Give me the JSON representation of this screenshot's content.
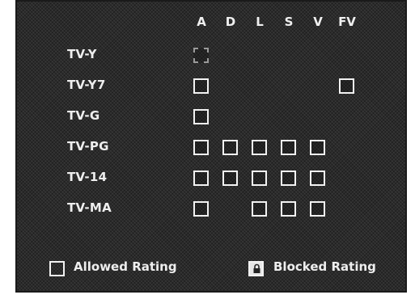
{
  "columns": [
    "A",
    "D",
    "L",
    "S",
    "V",
    "FV"
  ],
  "rows": [
    {
      "label": "TV-Y",
      "cells": [
        "A"
      ]
    },
    {
      "label": "TV-Y7",
      "cells": [
        "A",
        "FV"
      ]
    },
    {
      "label": "TV-G",
      "cells": [
        "A"
      ]
    },
    {
      "label": "TV-PG",
      "cells": [
        "A",
        "D",
        "L",
        "S",
        "V"
      ]
    },
    {
      "label": "TV-14",
      "cells": [
        "A",
        "D",
        "L",
        "S",
        "V"
      ]
    },
    {
      "label": "TV-MA",
      "cells": [
        "A",
        "L",
        "S",
        "V"
      ]
    }
  ],
  "legend": {
    "allowed_label": "Allowed Rating",
    "blocked_label": "Blocked Rating",
    "allowed_icon": "empty-box-icon",
    "blocked_icon": "lock-icon"
  },
  "colors": {
    "background": "#2b2b2b",
    "foreground": "#eeeeee"
  }
}
